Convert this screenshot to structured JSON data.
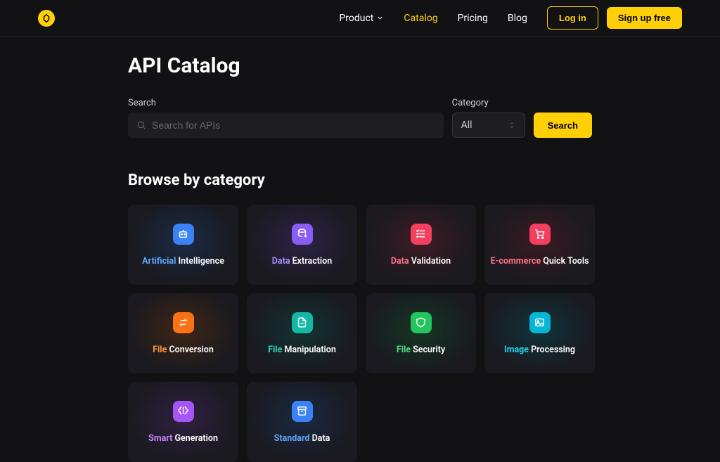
{
  "nav": {
    "items": [
      {
        "label": "Product",
        "dropdown": true
      },
      {
        "label": "Catalog",
        "active": true
      },
      {
        "label": "Pricing"
      },
      {
        "label": "Blog"
      }
    ],
    "login": "Log in",
    "signup": "Sign up free"
  },
  "page": {
    "title": "API Catalog",
    "search_label": "Search",
    "search_placeholder": "Search for APIs",
    "category_label": "Category",
    "category_value": "All",
    "search_btn": "Search",
    "browse_heading": "Browse by category"
  },
  "categories": [
    {
      "hl": "Artificial",
      "rest": " Intelligence",
      "icon": "bot"
    },
    {
      "hl": "Data",
      "rest": " Extraction",
      "icon": "db-export"
    },
    {
      "hl": "Data",
      "rest": " Validation",
      "icon": "checklist"
    },
    {
      "hl": "E-commerce",
      "rest": " Quick Tools",
      "icon": "cart"
    },
    {
      "hl": "File",
      "rest": " Conversion",
      "icon": "swap"
    },
    {
      "hl": "File",
      "rest": " Manipulation",
      "icon": "file-edit"
    },
    {
      "hl": "File",
      "rest": " Security",
      "icon": "shield"
    },
    {
      "hl": "Image",
      "rest": " Processing",
      "icon": "image"
    },
    {
      "hl": "Smart",
      "rest": " Generation",
      "icon": "brain"
    },
    {
      "hl": "Standard",
      "rest": " Data",
      "icon": "archive"
    }
  ]
}
